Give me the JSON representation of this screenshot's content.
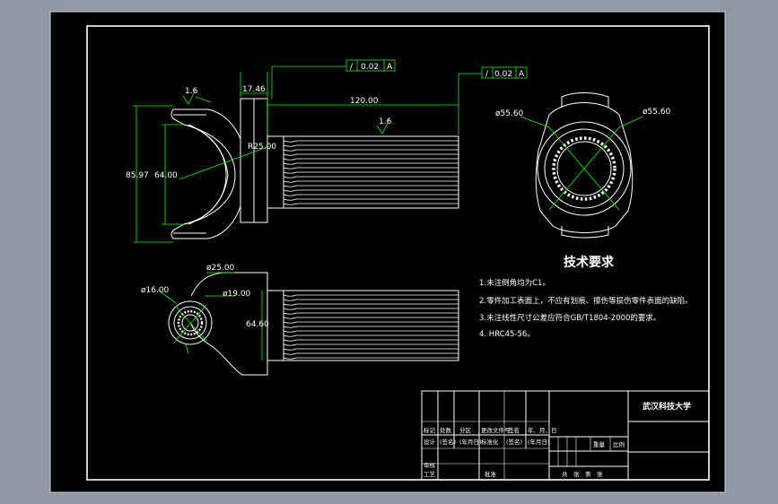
{
  "colors": {
    "background": "#8f98a3",
    "sheet": "#000000",
    "lines": "#ffffff",
    "dimension": "#00ff00",
    "text": "#ffffff"
  },
  "dimensions": {
    "d_17_46": "17.46",
    "d_120": "120.00",
    "d_85_97": "85.97",
    "d_64_top": "64.00",
    "r_25": "R25.00",
    "roughness_top": "1.6",
    "roughness_shaft": "1.6",
    "dia_55_left": "ø55.60",
    "dia_55_right": "ø55.60",
    "dia_25": "ø25.00",
    "dia_16": "ø16.00",
    "dia_19": "ø19.00",
    "d_64_bottom": "64.60",
    "tol_1_symbol": "/",
    "tol_1_value": "0.02",
    "tol_1_datum": "A",
    "tol_2_symbol": "/",
    "tol_2_value": "0.02",
    "tol_2_datum": "A"
  },
  "requirements": {
    "title": "技术要求",
    "items": [
      "1.未注倒角均为C1。",
      "2.零件加工表面上，不应有划痕、擦伤等损伤零件表面的缺陷。",
      "3.未注线性尺寸公差应符合GB/T1804-2000的要求。",
      "4. HRC45-56。"
    ]
  },
  "title_block": {
    "school": "武汉科技大学",
    "row1": [
      "标记",
      "处数",
      "分区",
      "更改文件号",
      "签名",
      "年、月、日"
    ],
    "row2": [
      "设计",
      "(签名)",
      "(年月日)",
      "标准化",
      "(签名)",
      "(年月日)"
    ],
    "row3": [
      "审核"
    ],
    "row4": [
      "工艺",
      "批准"
    ],
    "stage_label": "阶段标记",
    "weight_label": "重量",
    "scale_label": "比例",
    "sheet_label": "共　张　第　张"
  }
}
